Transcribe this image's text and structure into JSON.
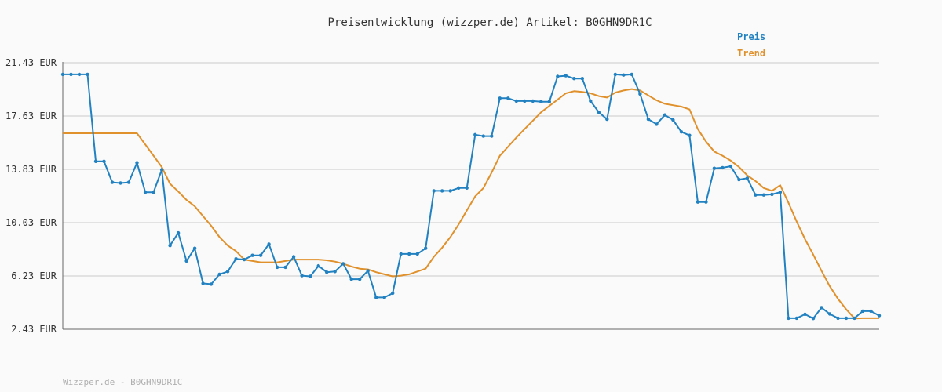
{
  "footer": "Wizzper.de - B0GHN9DR1C",
  "chart_data": {
    "type": "line",
    "title": "Preisentwicklung (wizzper.de) Artikel: B0GHN9DR1C",
    "xlabel": "",
    "ylabel": "",
    "ylim": [
      2.43,
      21.43
    ],
    "y_ticks": [
      "21.43 EUR",
      "17.63 EUR",
      "13.83 EUR",
      "10.03 EUR",
      "6.23 EUR",
      "2.43 EUR"
    ],
    "y_tick_values": [
      21.43,
      17.63,
      13.83,
      10.03,
      6.23,
      2.43
    ],
    "grid": true,
    "legend_position": "top-right",
    "colors": {
      "preis": "#2282c1",
      "trend": "#e0912c",
      "grid": "#e2e2e2",
      "axis": "#666666"
    },
    "series": [
      {
        "name": "Preis",
        "values": [
          20.6,
          20.6,
          20.6,
          20.6,
          14.4,
          14.4,
          12.9,
          12.85,
          12.9,
          14.3,
          12.2,
          12.2,
          13.8,
          8.4,
          9.3,
          7.3,
          8.2,
          5.7,
          5.65,
          6.35,
          6.55,
          7.45,
          7.4,
          7.7,
          7.7,
          8.5,
          6.85,
          6.85,
          7.6,
          6.25,
          6.2,
          6.95,
          6.5,
          6.55,
          7.1,
          6.0,
          6.0,
          6.6,
          4.7,
          4.7,
          5.0,
          7.8,
          7.8,
          7.8,
          8.2,
          12.3,
          12.3,
          12.3,
          12.5,
          12.5,
          16.3,
          16.2,
          16.2,
          18.9,
          18.9,
          18.7,
          18.7,
          18.7,
          18.65,
          18.65,
          20.45,
          20.5,
          20.3,
          20.3,
          18.7,
          17.9,
          17.4,
          20.6,
          20.55,
          20.6,
          19.2,
          17.4,
          17.05,
          17.7,
          17.35,
          16.5,
          16.25,
          11.5,
          11.5,
          13.9,
          13.95,
          14.05,
          13.1,
          13.2,
          12.0,
          12.0,
          12.05,
          12.2,
          3.22,
          3.22,
          3.5,
          3.2,
          3.97,
          3.52,
          3.22,
          3.22,
          3.22,
          3.72,
          3.72,
          3.4
        ]
      },
      {
        "name": "Trend",
        "values": [
          16.4,
          16.4,
          16.4,
          16.4,
          16.4,
          16.4,
          16.4,
          16.4,
          16.4,
          16.4,
          15.6,
          14.8,
          14.0,
          12.8,
          12.25,
          11.65,
          11.2,
          10.5,
          9.8,
          9.0,
          8.4,
          8.0,
          7.4,
          7.3,
          7.2,
          7.2,
          7.2,
          7.3,
          7.4,
          7.4,
          7.4,
          7.4,
          7.35,
          7.25,
          7.1,
          6.9,
          6.75,
          6.7,
          6.5,
          6.35,
          6.2,
          6.25,
          6.35,
          6.55,
          6.75,
          7.6,
          8.25,
          9.0,
          9.9,
          10.9,
          11.9,
          12.5,
          13.6,
          14.8,
          15.45,
          16.1,
          16.7,
          17.3,
          17.9,
          18.35,
          18.8,
          19.25,
          19.4,
          19.35,
          19.25,
          19.05,
          18.95,
          19.3,
          19.45,
          19.55,
          19.45,
          19.1,
          18.75,
          18.5,
          18.4,
          18.3,
          18.1,
          16.7,
          15.8,
          15.1,
          14.8,
          14.45,
          14.0,
          13.4,
          13.0,
          12.5,
          12.3,
          12.7,
          11.45,
          10.1,
          8.85,
          7.75,
          6.6,
          5.5,
          4.6,
          3.85,
          3.2,
          3.22,
          3.22,
          3.22
        ]
      }
    ]
  }
}
